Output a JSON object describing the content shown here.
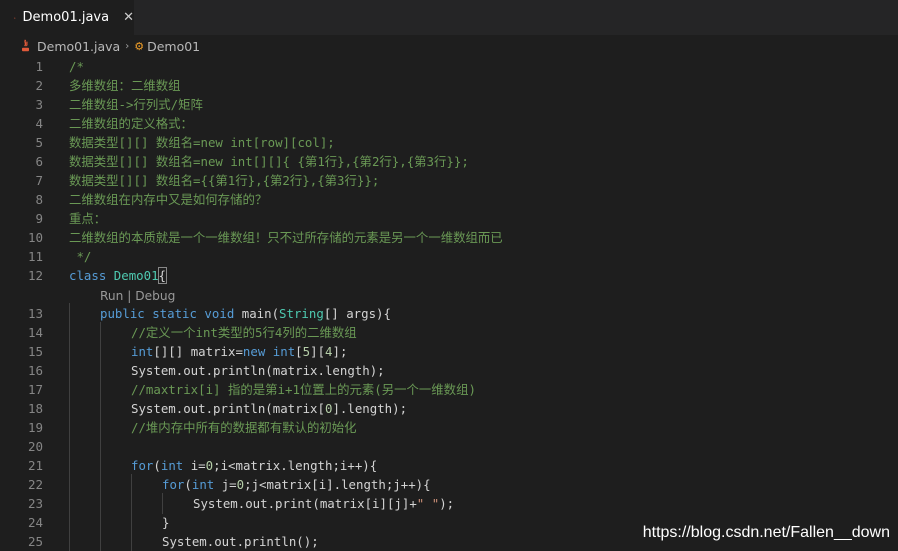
{
  "tab": {
    "title": "Demo01.java",
    "close_glyph": "✕",
    "icon": "java-icon"
  },
  "breadcrumb": {
    "file": "Demo01.java",
    "separator": "›",
    "symbol": "Demo01",
    "file_icon": "java-icon",
    "symbol_icon": "class-icon"
  },
  "codelens": {
    "run": "Run",
    "separator": " | ",
    "debug": "Debug"
  },
  "line_numbers": [
    "1",
    "2",
    "3",
    "4",
    "5",
    "6",
    "7",
    "8",
    "9",
    "10",
    "11",
    "12",
    "13",
    "14",
    "15",
    "16",
    "17",
    "18",
    "19",
    "20",
    "21",
    "22",
    "23",
    "24",
    "25"
  ],
  "code": {
    "l1": "/*",
    "l2": "多维数组：二维数组",
    "l3": "二维数组->行列式/矩阵",
    "l4": "二维数组的定义格式：",
    "l5": "数据类型[][] 数组名=new int[row][col];",
    "l6": "数据类型[][] 数组名=new int[][]{ {第1行},{第2行},{第3行}};",
    "l7": "数据类型[][] 数组名={{第1行},{第2行},{第3行}};",
    "l8": "二维数组在内存中又是如何存储的？",
    "l9": "重点：",
    "l10": "二维数组的本质就是一个一维数组！只不过所存储的元素是另一个一维数组而已",
    "l11": " */",
    "l12": {
      "kw": "class",
      "name": " Demo01",
      "brace": "{"
    },
    "l13": {
      "kw": "public static void",
      "name": " main(",
      "type": "String",
      "rest": "[] args){"
    },
    "l14": "//定义一个int类型的5行4列的二维数组",
    "l15": {
      "type": "int",
      "mid": "[][] matrix=",
      "kw": "new",
      "sp": " ",
      "type2": "int",
      "idx_open": "[",
      "n1": "5",
      "idx_mid": "][",
      "n2": "4",
      "end": "];"
    },
    "l16": "System.out.println(matrix.length);",
    "l17": "//maxtrix[i] 指的是第i+1位置上的元素(另一个一维数组)",
    "l18": {
      "pre": "System.out.println(matrix[",
      "n": "0",
      "post": "].length);"
    },
    "l19": "//堆内存中所有的数据都有默认的初始化",
    "l20": "",
    "l21": {
      "kw": "for",
      "open": "(",
      "type": "int",
      "mid": " i=",
      "n": "0",
      "rest": ";i<matrix.length;i++){"
    },
    "l22": {
      "kw": "for",
      "open": "(",
      "type": "int",
      "mid": " j=",
      "n": "0",
      "rest": ";j<matrix[i].length;j++){"
    },
    "l23": {
      "pre": "System.out.print(matrix[i][j]+",
      "str": "\" \"",
      "post": ");"
    },
    "l24": "}",
    "l25": "System.out.println();"
  },
  "watermark": "https://blog.csdn.net/Fallen__down",
  "colors": {
    "background": "#1e1e1e",
    "comment": "#6a9955",
    "keyword": "#569cd6",
    "type": "#4ec9b0",
    "string": "#ce9178",
    "number": "#b5cea8",
    "line_number": "#858585"
  }
}
